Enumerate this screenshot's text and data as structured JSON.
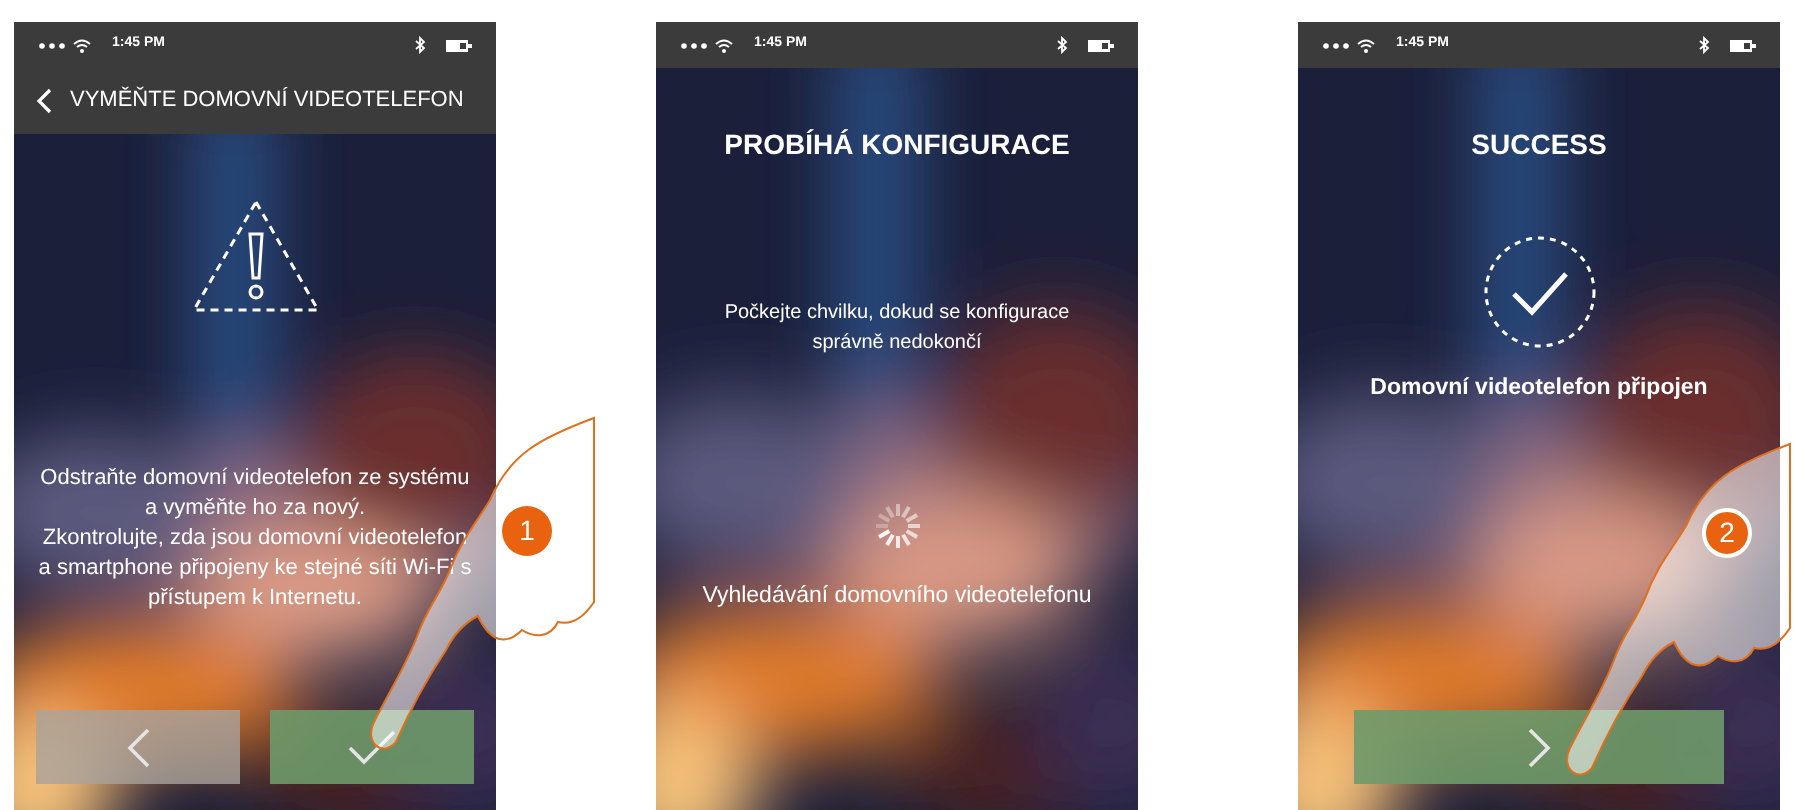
{
  "screens": [
    {
      "kind": "warning",
      "status_bar": {
        "time": "1:45 PM"
      },
      "header": {
        "title": "VYMĚŇTE DOMOVNÍ VIDEOTELEFON"
      },
      "message_lines": [
        "Odstraňte domovní videotelefon ze systému",
        "a vyměňte ho za nový.",
        "Zkontrolujte, zda jsou domovní videotelefon",
        "a smartphone připojeny ke stejné síti Wi-Fi s",
        "přístupem k Internetu."
      ],
      "buttons": [
        {
          "kind": "back"
        },
        {
          "kind": "confirm"
        }
      ],
      "step": "1"
    },
    {
      "kind": "progress",
      "status_bar": {
        "time": "1:45 PM"
      },
      "title": "PROBÍHÁ KONFIGURACE",
      "message_lines": [
        "Počkejte chvilku, dokud se konfigurace",
        "správně nedokončí"
      ],
      "status": "Vyhledávání domovního videotelefonu"
    },
    {
      "kind": "success",
      "status_bar": {
        "time": "1:45 PM"
      },
      "title": "SUCCESS",
      "message": "Domovní videotelefon připojen",
      "buttons": [
        {
          "kind": "next"
        }
      ],
      "step": "2"
    }
  ]
}
